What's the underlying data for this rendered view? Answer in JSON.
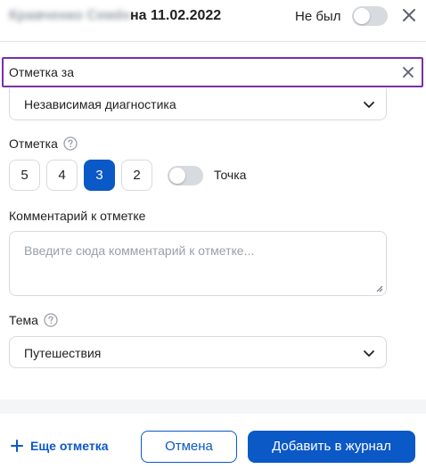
{
  "header": {
    "student_name": "Кравченко Семён",
    "date_title": "на 11.02.2022",
    "absent_label": "Не был",
    "absent_on": false
  },
  "mark_for": {
    "value": "Отметка за"
  },
  "assessment_type": {
    "selected": "Независимая диагностика"
  },
  "grade": {
    "label": "Отметка",
    "options": [
      "5",
      "4",
      "3",
      "2"
    ],
    "selected": "3",
    "dot_label": "Точка",
    "dot_on": false
  },
  "comment": {
    "label": "Комментарий к отметке",
    "placeholder": "Введите сюда комментарий к отметке...",
    "value": ""
  },
  "theme": {
    "label": "Тема",
    "selected": "Путешествия"
  },
  "footer": {
    "more_label": "Еще отметка",
    "cancel_label": "Отмена",
    "add_label": "Добавить в журнал"
  },
  "colors": {
    "accent": "#0b58c7",
    "focus_border": "#7b2fa8",
    "border": "#d7dade",
    "muted": "#9aa0a8"
  },
  "icons": {
    "close": "close-icon",
    "clear": "clear-icon",
    "chevron": "chevron-down-icon",
    "help": "help-icon",
    "plus": "plus-icon"
  }
}
